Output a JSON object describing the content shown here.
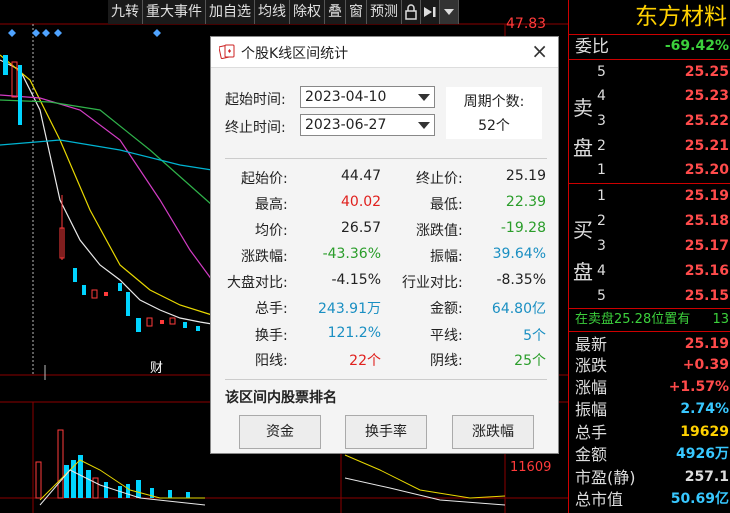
{
  "toolbar": {
    "buttons": [
      "九转",
      "重大事件",
      "加自选",
      "均线",
      "除权",
      "叠",
      "窗",
      "预测"
    ],
    "icons": [
      "lock-icon",
      "jump-to-end-icon",
      "dropdown-icon"
    ]
  },
  "chart_axis": {
    "price_label": "47.83",
    "volume_label": "11609"
  },
  "chart_markers": {
    "event_marker": "财"
  },
  "quote": {
    "stock_name": "东方材料",
    "weibi_label": "委比",
    "weibi_value": "-69.42%",
    "sell_label": [
      "卖",
      "盘"
    ],
    "sell": [
      {
        "level": "5",
        "price": "25.25"
      },
      {
        "level": "4",
        "price": "25.23"
      },
      {
        "level": "3",
        "price": "25.22"
      },
      {
        "level": "2",
        "price": "25.21"
      },
      {
        "level": "1",
        "price": "25.20"
      }
    ],
    "buy_label": [
      "买",
      "盘"
    ],
    "buy": [
      {
        "level": "1",
        "price": "25.19"
      },
      {
        "level": "2",
        "price": "25.18"
      },
      {
        "level": "3",
        "price": "25.17"
      },
      {
        "level": "4",
        "price": "25.16"
      },
      {
        "level": "5",
        "price": "25.15"
      }
    ],
    "notice": "在卖盘25.28位置有",
    "notice_value": "13",
    "stats": [
      {
        "label": "最新",
        "value": "25.19"
      },
      {
        "label": "涨跌",
        "value": "+0.39"
      },
      {
        "label": "涨幅",
        "value": "+1.57%"
      },
      {
        "label": "振幅",
        "value": "2.74%"
      },
      {
        "label": "总手",
        "value": "19629"
      },
      {
        "label": "金额",
        "value": "4926万"
      },
      {
        "label": "市盈(静)",
        "value": "257.1"
      },
      {
        "label": "总市值",
        "value": "50.69亿"
      }
    ]
  },
  "dialog": {
    "title": "个股K线区间统计",
    "start_label": "起始时间:",
    "start_value": "2023-04-10",
    "end_label": "终止时间:",
    "end_value": "2023-06-27",
    "period_label": "周期个数:",
    "period_value": "52个",
    "stats": {
      "start_price_label": "起始价:",
      "start_price": "44.47",
      "end_price_label": "终止价:",
      "end_price": "25.19",
      "high_label": "最高:",
      "high": "40.02",
      "low_label": "最低:",
      "low": "22.39",
      "avg_label": "均价:",
      "avg": "26.57",
      "change_val_label": "涨跌值:",
      "change_val": "-19.28",
      "change_pct_label": "涨跌幅:",
      "change_pct": "-43.36%",
      "amplitude_label": "振幅:",
      "amplitude": "39.64%",
      "market_cmp_label": "大盘对比:",
      "market_cmp": "-4.15%",
      "industry_cmp_label": "行业对比:",
      "industry_cmp": "-8.35%",
      "volume_label": "总手:",
      "volume": "243.91万",
      "amount_label": "金额:",
      "amount": "64.80亿",
      "turnover_label": "换手:",
      "turnover": "121.2%",
      "flat_label": "平线:",
      "flat": "5个",
      "up_label": "阳线:",
      "up": "22个",
      "down_label": "阴线:",
      "down": "25个"
    },
    "ranking_title": "该区间内股票排名",
    "buttons": [
      "资金",
      "换手率",
      "涨跌幅"
    ]
  }
}
